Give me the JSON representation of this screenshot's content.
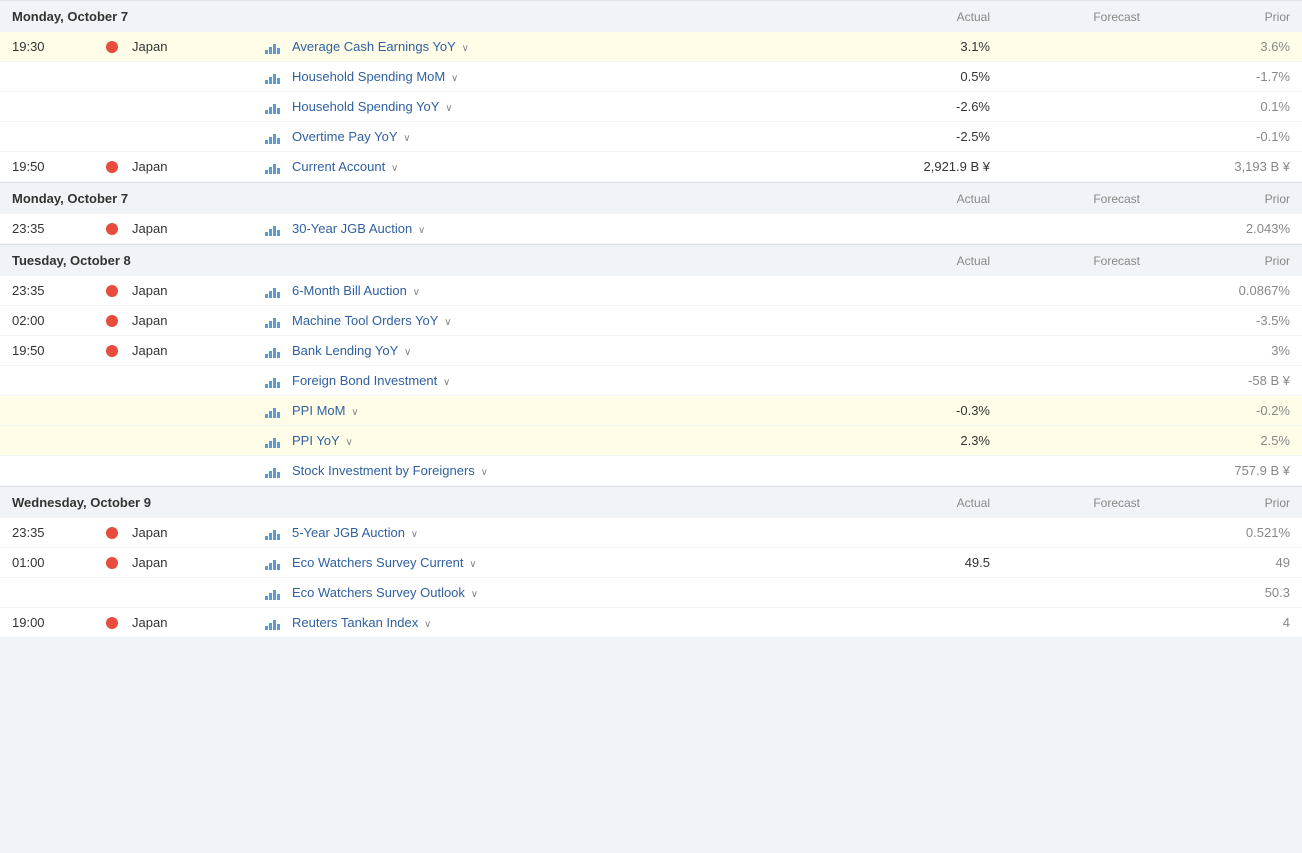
{
  "sections": [
    {
      "day": "Monday, October 7",
      "showHeader": true,
      "headerLabels": {
        "actual": "Actual",
        "forecast": "Forecast",
        "prior": "Prior"
      },
      "events": [
        {
          "time": "19:30",
          "flag": true,
          "country": "Japan",
          "event": "Average Cash Earnings YoY",
          "actual": "3.1%",
          "forecast": "",
          "prior": "3.6%",
          "highlighted": true
        },
        {
          "time": "",
          "flag": false,
          "country": "",
          "event": "Household Spending MoM",
          "actual": "0.5%",
          "forecast": "",
          "prior": "-1.7%",
          "highlighted": false
        },
        {
          "time": "",
          "flag": false,
          "country": "",
          "event": "Household Spending YoY",
          "actual": "-2.6%",
          "forecast": "",
          "prior": "0.1%",
          "highlighted": false
        },
        {
          "time": "",
          "flag": false,
          "country": "",
          "event": "Overtime Pay YoY",
          "actual": "-2.5%",
          "forecast": "",
          "prior": "-0.1%",
          "highlighted": false
        },
        {
          "time": "19:50",
          "flag": true,
          "country": "Japan",
          "event": "Current Account",
          "actual": "2,921.9 B ¥",
          "forecast": "",
          "prior": "3,193 B ¥",
          "highlighted": false
        }
      ]
    },
    {
      "day": "Monday, October 7",
      "showHeader": true,
      "headerLabels": {
        "actual": "Actual",
        "forecast": "Forecast",
        "prior": "Prior"
      },
      "events": [
        {
          "time": "23:35",
          "flag": true,
          "country": "Japan",
          "event": "30-Year JGB Auction",
          "actual": "",
          "forecast": "",
          "prior": "2.043%",
          "highlighted": false
        }
      ]
    },
    {
      "day": "Tuesday, October 8",
      "showHeader": true,
      "headerLabels": {
        "actual": "Actual",
        "forecast": "Forecast",
        "prior": "Prior"
      },
      "events": [
        {
          "time": "23:35",
          "flag": true,
          "country": "Japan",
          "event": "6-Month Bill Auction",
          "actual": "",
          "forecast": "",
          "prior": "0.0867%",
          "highlighted": false
        },
        {
          "time": "02:00",
          "flag": true,
          "country": "Japan",
          "event": "Machine Tool Orders YoY",
          "actual": "",
          "forecast": "",
          "prior": "-3.5%",
          "highlighted": false
        },
        {
          "time": "19:50",
          "flag": true,
          "country": "Japan",
          "event": "Bank Lending YoY",
          "actual": "",
          "forecast": "",
          "prior": "3%",
          "highlighted": false
        },
        {
          "time": "",
          "flag": false,
          "country": "",
          "event": "Foreign Bond Investment",
          "actual": "",
          "forecast": "",
          "prior": "-58 B ¥",
          "highlighted": false
        },
        {
          "time": "",
          "flag": false,
          "country": "",
          "event": "PPI MoM",
          "actual": "-0.3%",
          "forecast": "",
          "prior": "-0.2%",
          "highlighted": true
        },
        {
          "time": "",
          "flag": false,
          "country": "",
          "event": "PPI YoY",
          "actual": "2.3%",
          "forecast": "",
          "prior": "2.5%",
          "highlighted": true
        },
        {
          "time": "",
          "flag": false,
          "country": "",
          "event": "Stock Investment by Foreigners",
          "actual": "",
          "forecast": "",
          "prior": "757.9 B ¥",
          "highlighted": false
        }
      ]
    },
    {
      "day": "Wednesday, October 9",
      "showHeader": true,
      "headerLabels": {
        "actual": "Actual",
        "forecast": "Forecast",
        "prior": "Prior"
      },
      "events": [
        {
          "time": "23:35",
          "flag": true,
          "country": "Japan",
          "event": "5-Year JGB Auction",
          "actual": "",
          "forecast": "",
          "prior": "0.521%",
          "highlighted": false
        },
        {
          "time": "01:00",
          "flag": true,
          "country": "Japan",
          "event": "Eco Watchers Survey Current",
          "actual": "49.5",
          "forecast": "",
          "prior": "49",
          "highlighted": false
        },
        {
          "time": "",
          "flag": false,
          "country": "",
          "event": "Eco Watchers Survey Outlook",
          "actual": "",
          "forecast": "",
          "prior": "50.3",
          "highlighted": false
        },
        {
          "time": "19:00",
          "flag": true,
          "country": "Japan",
          "event": "Reuters Tankan Index",
          "actual": "",
          "forecast": "",
          "prior": "4",
          "highlighted": false
        }
      ]
    }
  ]
}
